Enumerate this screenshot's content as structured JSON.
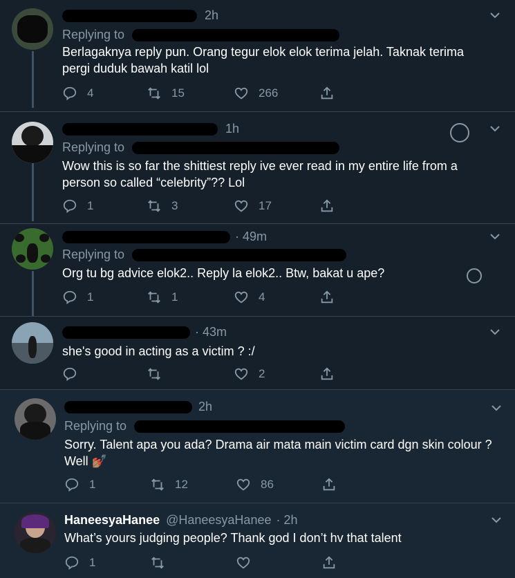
{
  "tweets": [
    {
      "time": "2h",
      "replying_label": "Replying to",
      "text": "Berlagaknya reply pun. Orang tegur elok elok terima jelah. Taknak terima pergi duduk bawah katil lol",
      "replies": "4",
      "retweets": "15",
      "likes": "266"
    },
    {
      "time": "1h",
      "replying_label": "Replying to",
      "text": "Wow this is so far the shittiest reply ive ever read in my entire life from a person so called “celebrity”?? Lol",
      "replies": "1",
      "retweets": "3",
      "likes": "17"
    },
    {
      "time": "· 49m",
      "replying_label": "Replying to",
      "text": "Org tu bg advice elok2.. Reply la elok2.. Btw, bakat u ape?",
      "replies": "1",
      "retweets": "1",
      "likes": "4"
    },
    {
      "time": "· 43m",
      "text": "she's good in acting as a victim ? :/",
      "replies": "",
      "retweets": "",
      "likes": "2"
    },
    {
      "time": "2h",
      "replying_label": "Replying to",
      "text": "Sorry. Talent apa you ada? Drama air mata main victim card dgn skin colour ? Well 💅🏽",
      "replies": "1",
      "retweets": "12",
      "likes": "86"
    },
    {
      "name": "HaneesyaHanee",
      "handle": "@HaneesyaHanee",
      "time": "· 2h",
      "text": "What’s yours judging people? Thank god I don’t hv that talent",
      "replies": "1",
      "retweets": "",
      "likes": ""
    }
  ],
  "colors": {
    "background": "#15202b",
    "secondary_text": "#8899a6",
    "divider": "#38444d"
  }
}
